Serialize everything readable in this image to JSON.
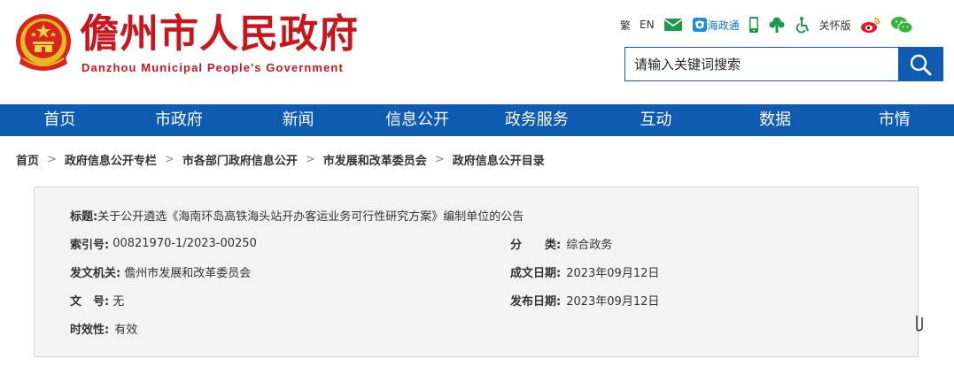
{
  "header": {
    "title": "儋州市人民政府",
    "subtitle": "Danzhou Municipal People's Government",
    "brand_color": "#c8161d"
  },
  "tools": {
    "traditional": "繁",
    "english": "EN",
    "haizhengtong": "海政通",
    "care": "关怀版",
    "icons": [
      "mail-icon",
      "haizhengtong-icon",
      "mobile-icon",
      "tree-icon",
      "accessibility-icon",
      "weibo-icon",
      "wechat-icon"
    ]
  },
  "search": {
    "placeholder": "请输入关键词搜索",
    "button_icon": "search-icon"
  },
  "nav": {
    "items": [
      "首页",
      "市政府",
      "新闻",
      "信息公开",
      "政务服务",
      "互动",
      "数据",
      "市情"
    ],
    "color": "#0e5bb1"
  },
  "breadcrumb": [
    "首页",
    "政府信息公开专栏",
    "市各部门政府信息公开",
    "市发展和改革委员会",
    "政府信息公开目录"
  ],
  "info": {
    "title_label": "标题:",
    "title_value": "关于公开遴选《海南环岛高铁海头站开办客运业务可行性研究方案》编制单位的公告",
    "index_label": "索引号:",
    "index_value": "00821970-1/2023-00250",
    "category_label": "分　　类:",
    "category_value": "综合政务",
    "issuer_label": "发文机关:",
    "issuer_value": "儋州市发展和改革委员会",
    "written_date_label": "成文日期:",
    "written_date_value": "2023年09月12日",
    "doc_no_label": "文　号:",
    "doc_no_value": "无",
    "publish_date_label": "发布日期:",
    "publish_date_value": "2023年09月12日",
    "validity_label": "时效性:",
    "validity_value": "有效"
  }
}
